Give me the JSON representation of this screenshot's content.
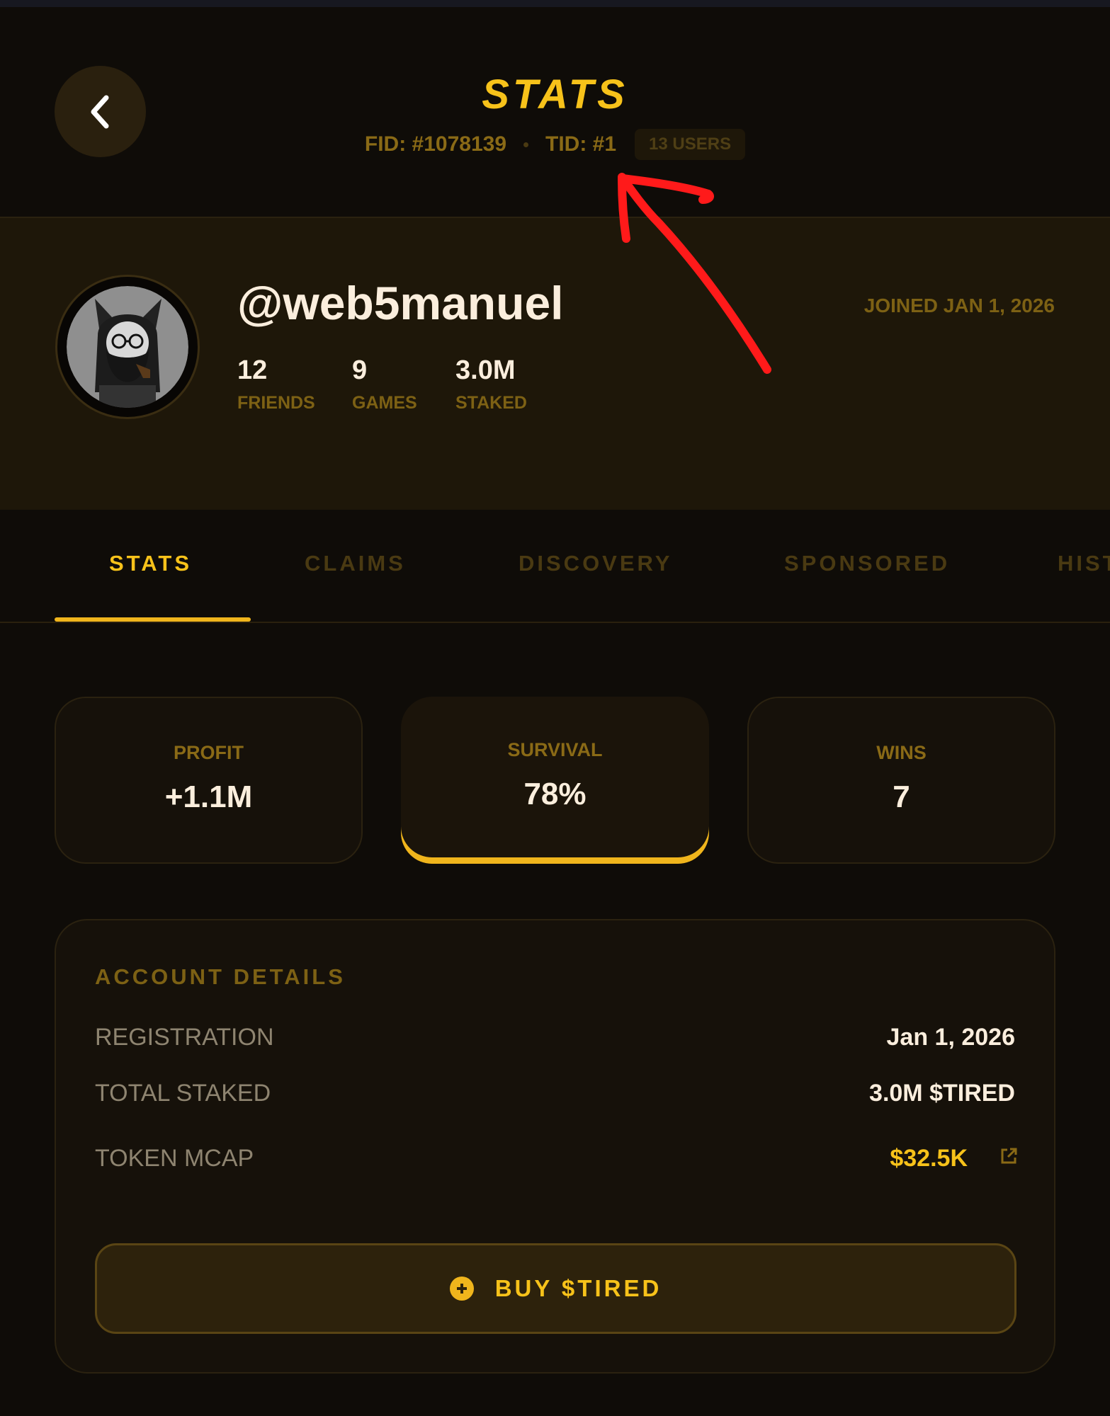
{
  "header": {
    "title": "STATS",
    "fid": "FID: #1078139",
    "tid": "TID: #1",
    "users_badge": "13 USERS"
  },
  "profile": {
    "username": "@web5manuel",
    "joined": "JOINED JAN 1, 2026",
    "stats": [
      {
        "value": "12",
        "label": "FRIENDS"
      },
      {
        "value": "9",
        "label": "GAMES"
      },
      {
        "value": "3.0M",
        "label": "STAKED"
      }
    ]
  },
  "tabs": [
    {
      "label": "STATS",
      "active": true
    },
    {
      "label": "CLAIMS",
      "active": false
    },
    {
      "label": "DISCOVERY",
      "active": false
    },
    {
      "label": "SPONSORED",
      "active": false
    },
    {
      "label": "HIST",
      "active": false
    }
  ],
  "cards": [
    {
      "label": "PROFIT",
      "value": "+1.1M"
    },
    {
      "label": "SURVIVAL",
      "value": "78%"
    },
    {
      "label": "WINS",
      "value": "7"
    }
  ],
  "account": {
    "title": "ACCOUNT DETAILS",
    "rows": [
      {
        "label": "REGISTRATION",
        "value": "Jan 1, 2026"
      },
      {
        "label": "TOTAL STAKED",
        "value": "3.0M $TIRED"
      },
      {
        "label": "TOKEN MCAP",
        "value": "$32.5K"
      }
    ],
    "buy_label": "BUY $TIRED"
  },
  "colors": {
    "accent": "#f7c21a",
    "background": "#0f0c08",
    "panel": "#1e1709",
    "annotation": "#ff1a1a"
  },
  "icons": [
    "chevron-left-icon",
    "external-link-icon",
    "plus-circle-icon",
    "avatar-icon"
  ]
}
